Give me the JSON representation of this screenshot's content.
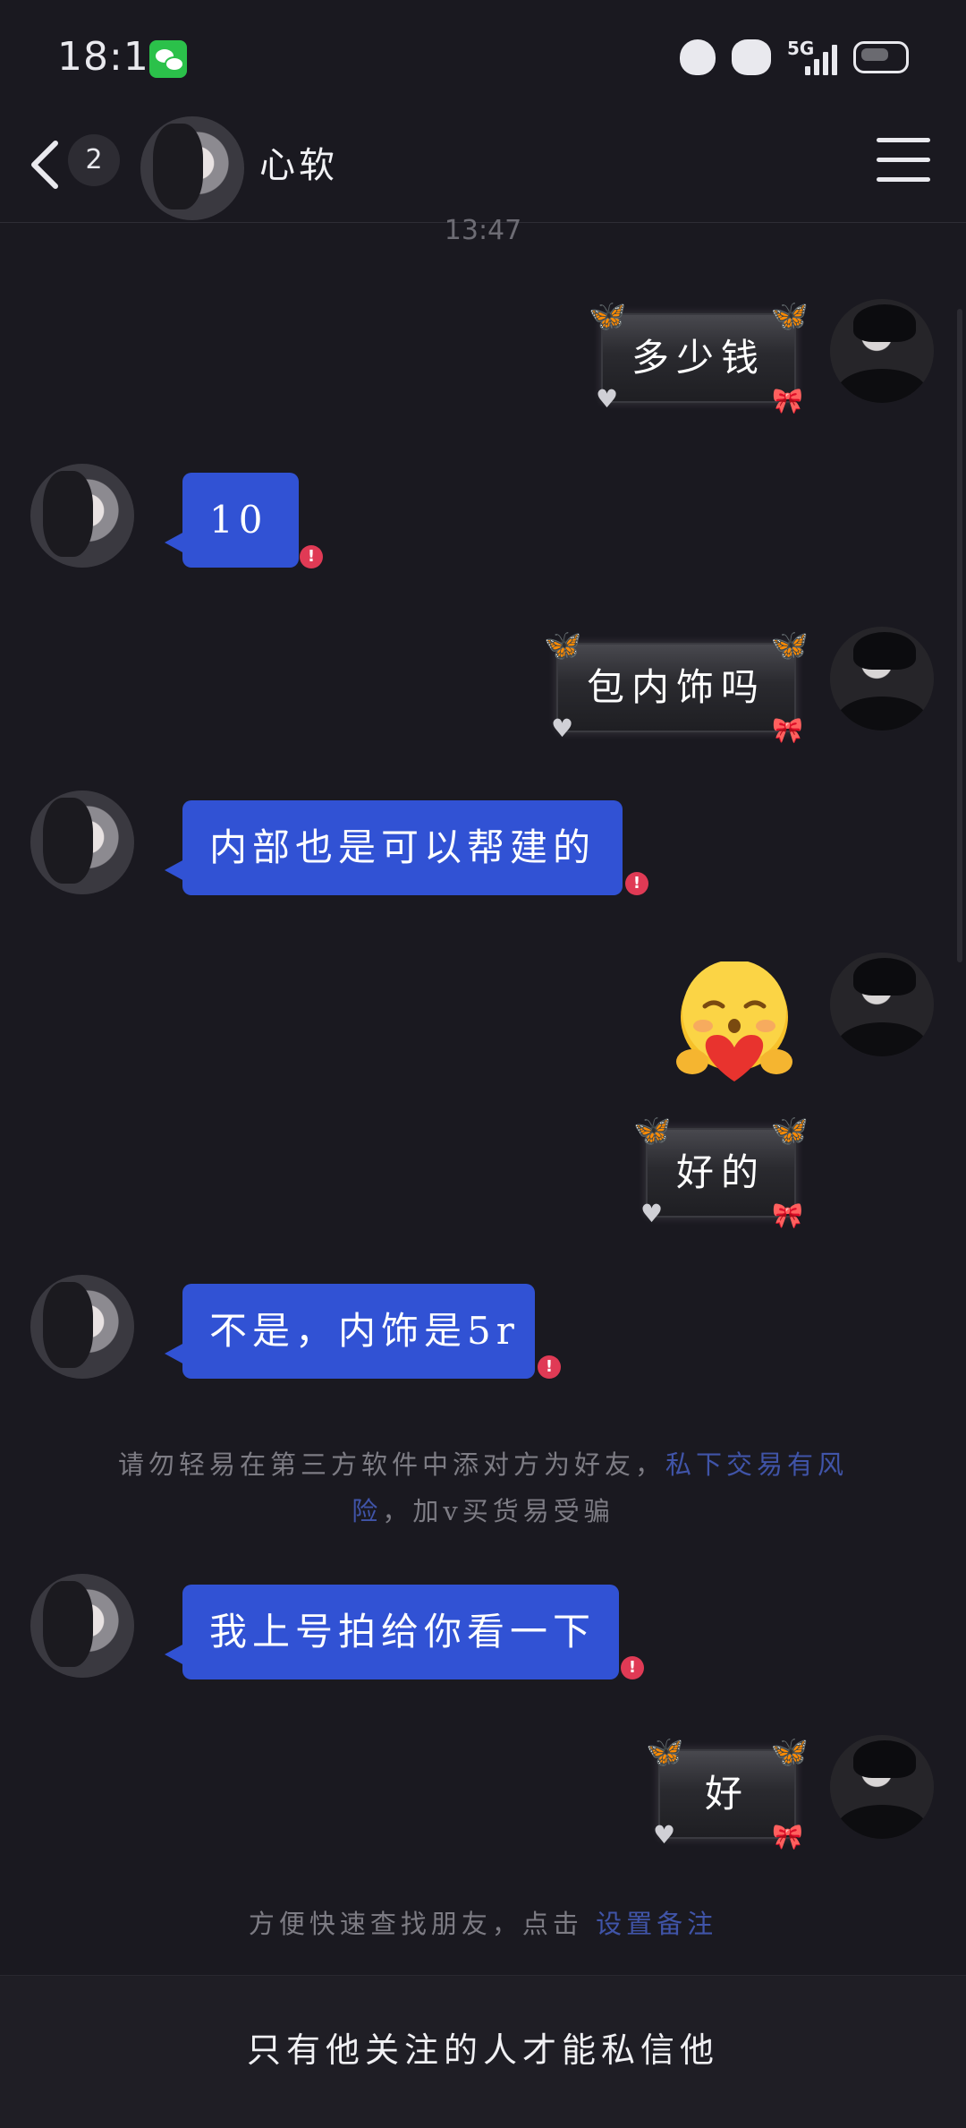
{
  "status_bar": {
    "time": "18:12",
    "network": "5G"
  },
  "header": {
    "unread_count": "2",
    "contact_name": "心软"
  },
  "timestamp": "13:47",
  "messages": [
    {
      "side": "out",
      "text": "多少钱"
    },
    {
      "side": "in",
      "text": "10"
    },
    {
      "side": "out",
      "text": "包内饰吗"
    },
    {
      "side": "in",
      "text": "内部也是可以帮建的"
    },
    {
      "side": "out",
      "sticker": "heart-hug-emoji"
    },
    {
      "side": "out",
      "text": "好的"
    },
    {
      "side": "in",
      "text": "不是，内饰是5r"
    },
    {
      "side": "in",
      "text": "我上号拍给你看一下"
    },
    {
      "side": "out",
      "text": "好"
    }
  ],
  "warning": {
    "prefix": "请勿轻易在第三方软件中添对方为好友，",
    "link_part1": "私下交易有风",
    "link_part2": "险",
    "suffix": "，加v买货易受骗"
  },
  "remark_hint": {
    "text": "方便快速查找朋友，点击 ",
    "link": "设置备注"
  },
  "footer": {
    "text": "只有他关注的人才能私信他"
  },
  "error_mark": "!"
}
